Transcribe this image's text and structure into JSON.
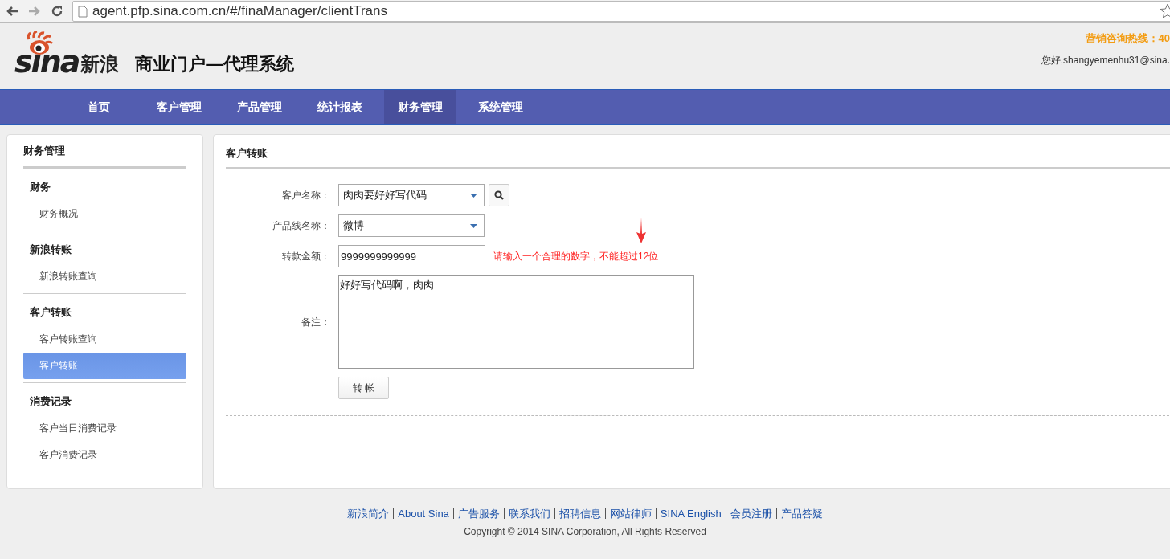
{
  "browser": {
    "url": "agent.pfp.sina.com.cn/#/finaManager/clientTrans"
  },
  "header": {
    "logo_wordmark": "sina",
    "logo_chinese": "新浪",
    "system_title": "商业门户—代理系统",
    "hotline": "营销咨询热线：40",
    "greeting": "您好,shangyemenhu31@sina."
  },
  "nav": [
    {
      "label": "首页",
      "selected": false
    },
    {
      "label": "客户管理",
      "selected": false
    },
    {
      "label": "产品管理",
      "selected": false
    },
    {
      "label": "统计报表",
      "selected": false
    },
    {
      "label": "财务管理",
      "selected": true
    },
    {
      "label": "系统管理",
      "selected": false
    }
  ],
  "sidebar": {
    "title": "财务管理",
    "groups": [
      {
        "heading": "财务",
        "items": [
          {
            "label": "财务概况",
            "selected": false
          }
        ]
      },
      {
        "heading": "新浪转账",
        "items": [
          {
            "label": "新浪转账查询",
            "selected": false
          }
        ]
      },
      {
        "heading": "客户转账",
        "items": [
          {
            "label": "客户转账查询",
            "selected": false
          },
          {
            "label": "客户转账",
            "selected": true
          }
        ]
      },
      {
        "heading": "消费记录",
        "items": [
          {
            "label": "客户当日消费记录",
            "selected": false
          },
          {
            "label": "客户消费记录",
            "selected": false
          }
        ]
      }
    ]
  },
  "panel": {
    "title": "客户转账",
    "fields": [
      {
        "kind": "select",
        "label": "客户名称：",
        "value": "肉肉要好好写代码",
        "search_button": true
      },
      {
        "kind": "select",
        "label": "产品线名称：",
        "value": "微博",
        "search_button": false
      },
      {
        "kind": "input",
        "label": "转款金额：",
        "value": "9999999999999",
        "error": "请输入一个合理的数字，不能超过12位"
      },
      {
        "kind": "textarea",
        "label": "备注：",
        "value": "好好写代码啊，肉肉"
      }
    ],
    "submit": "转 帐"
  },
  "footer": {
    "links": [
      "新浪简介",
      "About Sina",
      "广告服务",
      "联系我们",
      "招聘信息",
      "网站律师",
      "SINA English",
      "会员注册",
      "产品答疑"
    ],
    "copyright": "Copyright © 2014 SINA Corporation, All Rights Reserved"
  }
}
